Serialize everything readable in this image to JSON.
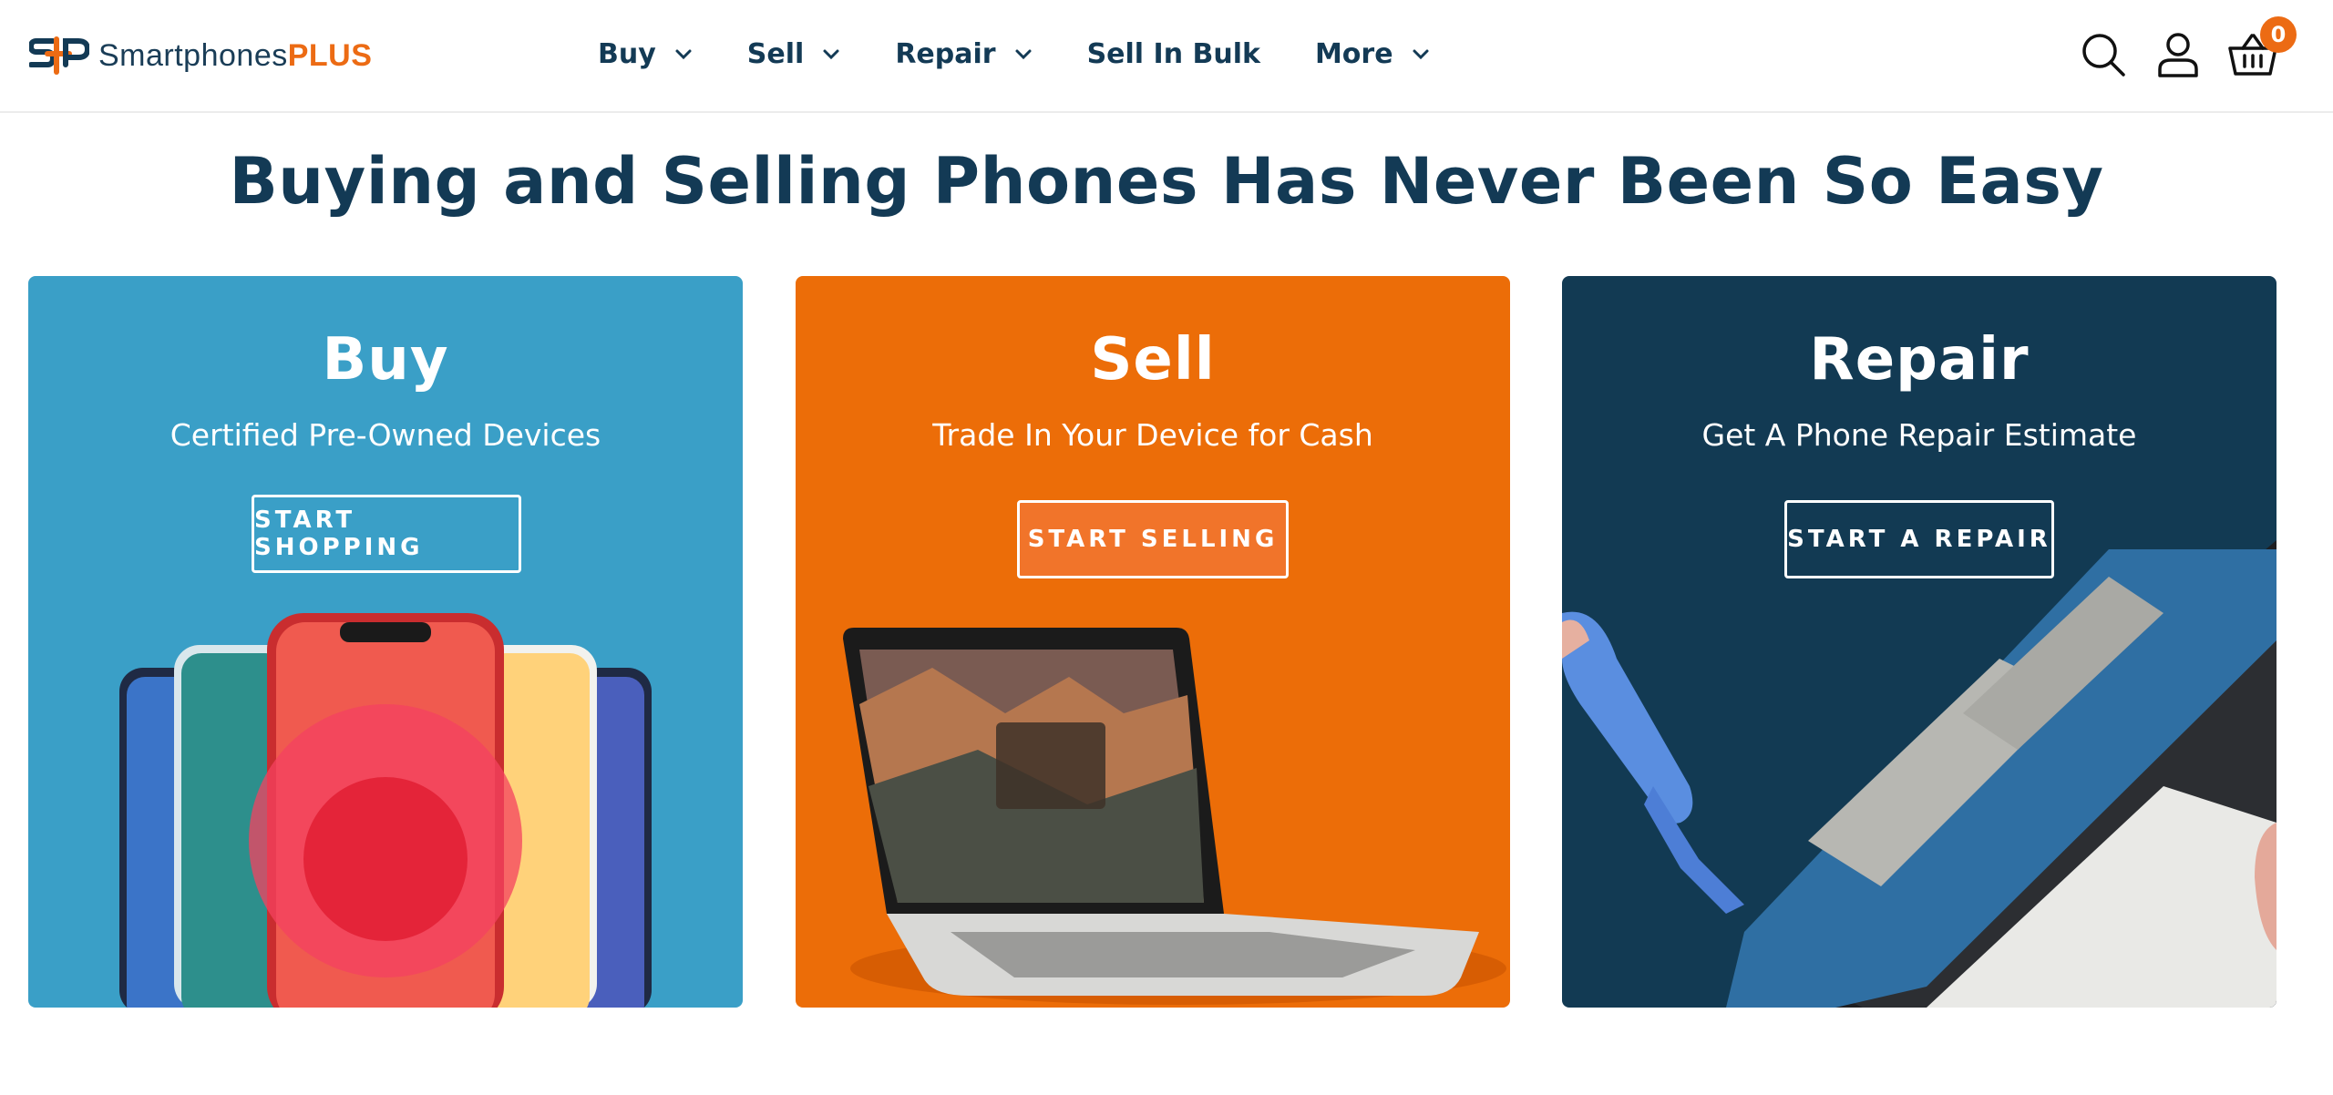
{
  "brand": {
    "name_part1": "Smartphones",
    "name_part2": "PLUS",
    "colors": {
      "navy": "#133a55",
      "orange": "#ec6b14",
      "blue": "#3a9fc7",
      "dark": "#123a53"
    }
  },
  "nav": {
    "items": [
      {
        "label": "Buy",
        "has_dropdown": true
      },
      {
        "label": "Sell",
        "has_dropdown": true
      },
      {
        "label": "Repair",
        "has_dropdown": true
      },
      {
        "label": "Sell In Bulk",
        "has_dropdown": false
      },
      {
        "label": "More",
        "has_dropdown": true
      }
    ]
  },
  "header_icons": {
    "search": "search-icon",
    "account": "user-icon",
    "cart": "basket-icon",
    "cart_count": "0"
  },
  "headline": "Buying and Selling Phones Has Never Been So Easy",
  "cards": [
    {
      "title": "Buy",
      "subtitle": "Certified Pre-Owned Devices",
      "button": "START SHOPPING"
    },
    {
      "title": "Sell",
      "subtitle": "Trade In Your Device for Cash",
      "button": "START SELLING"
    },
    {
      "title": "Repair",
      "subtitle": "Get A Phone Repair Estimate",
      "button": "START A REPAIR"
    }
  ]
}
